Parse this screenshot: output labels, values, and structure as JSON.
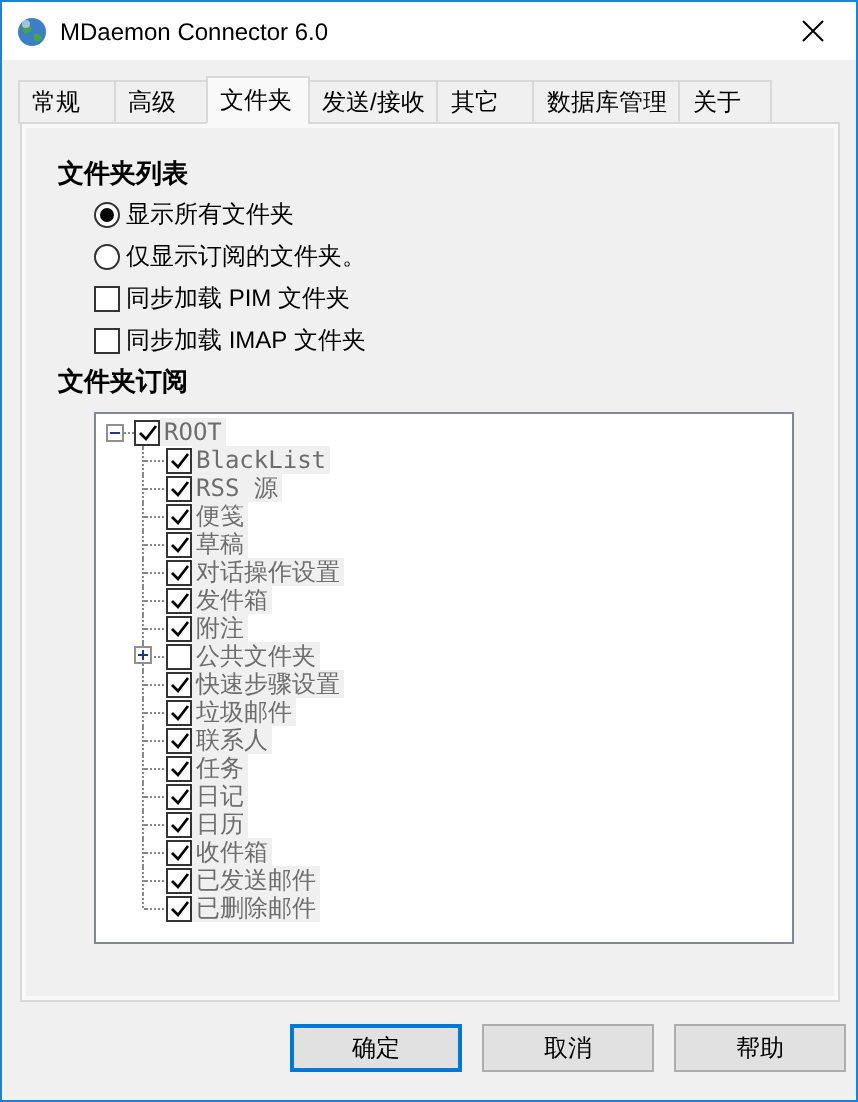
{
  "window": {
    "title": "MDaemon Connector 6.0"
  },
  "tabs": [
    {
      "label": "常规",
      "selected": false
    },
    {
      "label": "高级",
      "selected": false
    },
    {
      "label": "文件夹",
      "selected": true
    },
    {
      "label": "发送/接收",
      "selected": false
    },
    {
      "label": "其它",
      "selected": false
    },
    {
      "label": "数据库管理",
      "selected": false
    },
    {
      "label": "关于",
      "selected": false
    }
  ],
  "folder_list": {
    "title": "文件夹列表",
    "options": [
      {
        "kind": "radio",
        "label": "显示所有文件夹",
        "selected": true
      },
      {
        "kind": "radio",
        "label": "仅显示订阅的文件夹。",
        "selected": false
      },
      {
        "kind": "checkbox",
        "label": "同步加载 PIM 文件夹",
        "checked": false
      },
      {
        "kind": "checkbox",
        "label": "同步加载 IMAP 文件夹",
        "checked": false
      }
    ]
  },
  "subscription": {
    "title": "文件夹订阅",
    "tree": {
      "disabled": true,
      "items": [
        {
          "label": "ROOT",
          "checked": true,
          "expanded": true,
          "children": [
            {
              "label": "BlackList",
              "checked": true
            },
            {
              "label": "RSS 源",
              "checked": true
            },
            {
              "label": "便笺",
              "checked": true
            },
            {
              "label": "草稿",
              "checked": true
            },
            {
              "label": "对话操作设置",
              "checked": true
            },
            {
              "label": "发件箱",
              "checked": true
            },
            {
              "label": "附注",
              "checked": true
            },
            {
              "label": "公共文件夹",
              "checked": false,
              "expanded": false
            },
            {
              "label": "快速步骤设置",
              "checked": true
            },
            {
              "label": "垃圾邮件",
              "checked": true
            },
            {
              "label": "联系人",
              "checked": true
            },
            {
              "label": "任务",
              "checked": true
            },
            {
              "label": "日记",
              "checked": true
            },
            {
              "label": "日历",
              "checked": true
            },
            {
              "label": "收件箱",
              "checked": true
            },
            {
              "label": "已发送邮件",
              "checked": true
            },
            {
              "label": "已删除邮件",
              "checked": true
            }
          ]
        }
      ]
    }
  },
  "buttons": [
    {
      "label": "确定",
      "default": true
    },
    {
      "label": "取消",
      "default": false
    },
    {
      "label": "帮助",
      "default": false
    }
  ]
}
